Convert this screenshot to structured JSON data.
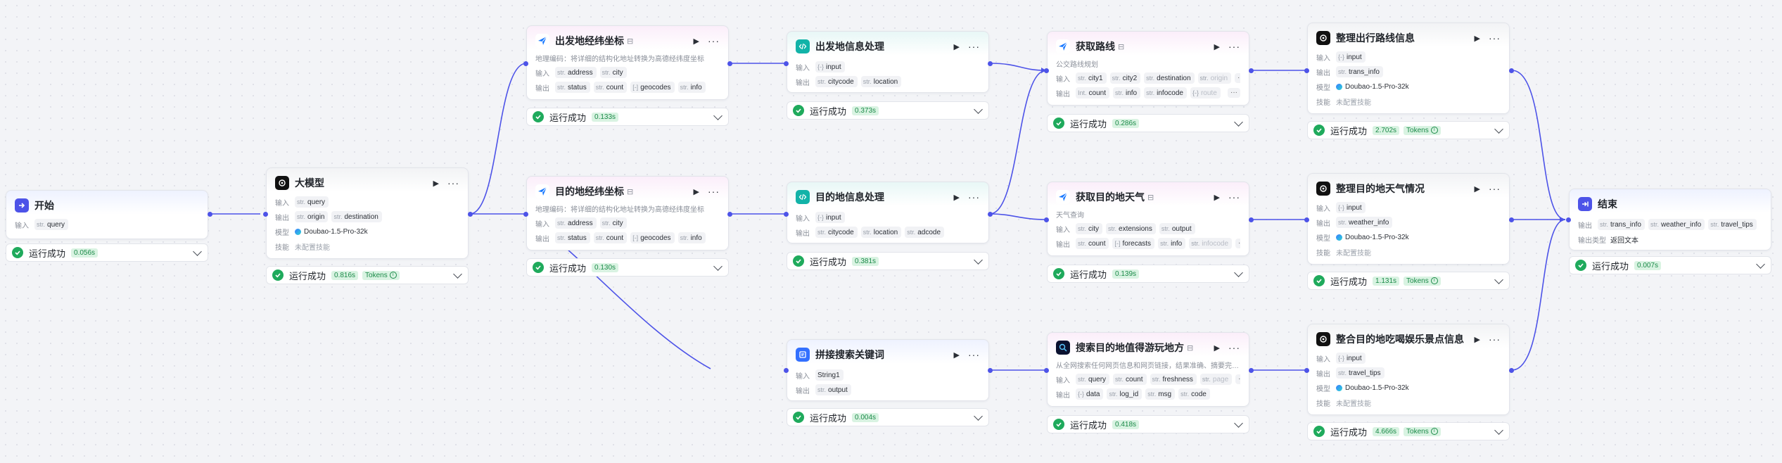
{
  "nodes": {
    "start": {
      "title": "开始",
      "in_label": "输入",
      "params": [
        {
          "t": "str.",
          "n": "query"
        }
      ],
      "status": "运行成功",
      "time": "0.056s"
    },
    "llm": {
      "title": "大模型",
      "in_label": "输入",
      "out_label": "输出",
      "model_label": "模型",
      "skill_label": "技能",
      "inputs": [
        {
          "t": "str.",
          "n": "query"
        }
      ],
      "outputs": [
        {
          "t": "str.",
          "n": "origin"
        },
        {
          "t": "str.",
          "n": "destination"
        }
      ],
      "model": "Doubao-1.5-Pro-32k",
      "skill": "未配置技能",
      "status": "运行成功",
      "time": "0.816s",
      "tokens": "Tokens"
    },
    "geo1": {
      "title": "出发地经纬坐标",
      "desc": "地理编码：将详细的结构化地址转换为高德经纬度坐标",
      "in_label": "输入",
      "out_label": "输出",
      "inputs": [
        {
          "t": "str.",
          "n": "address"
        },
        {
          "t": "str.",
          "n": "city"
        }
      ],
      "outputs": [
        {
          "t": "str.",
          "n": "status"
        },
        {
          "t": "str.",
          "n": "count"
        },
        {
          "t": "[-]",
          "n": "geocodes"
        },
        {
          "t": "str.",
          "n": "info"
        }
      ],
      "status": "运行成功",
      "time": "0.133s"
    },
    "geo2": {
      "title": "目的地经纬坐标",
      "desc": "地理编码：将详细的结构化地址转换为高德经纬度坐标",
      "in_label": "输入",
      "out_label": "输出",
      "inputs": [
        {
          "t": "str.",
          "n": "address"
        },
        {
          "t": "str.",
          "n": "city"
        }
      ],
      "outputs": [
        {
          "t": "str.",
          "n": "status"
        },
        {
          "t": "str.",
          "n": "count"
        },
        {
          "t": "[-]",
          "n": "geocodes"
        },
        {
          "t": "str.",
          "n": "info"
        }
      ],
      "status": "运行成功",
      "time": "0.130s"
    },
    "code1": {
      "title": "出发地信息处理",
      "in_label": "输入",
      "out_label": "输出",
      "inputs": [
        {
          "t": "{-}",
          "n": "input"
        }
      ],
      "outputs": [
        {
          "t": "str.",
          "n": "citycode"
        },
        {
          "t": "str.",
          "n": "location"
        }
      ],
      "status": "运行成功",
      "time": "0.373s"
    },
    "code2": {
      "title": "目的地信息处理",
      "in_label": "输入",
      "out_label": "输出",
      "inputs": [
        {
          "t": "{-}",
          "n": "input"
        }
      ],
      "outputs": [
        {
          "t": "str.",
          "n": "citycode"
        },
        {
          "t": "str.",
          "n": "location"
        },
        {
          "t": "str.",
          "n": "adcode"
        }
      ],
      "status": "运行成功",
      "time": "0.381s"
    },
    "text": {
      "title": "拼接搜索关键词",
      "in_label": "输入",
      "out_label": "输出",
      "inputs": [
        {
          "t": "",
          "n": "String1"
        }
      ],
      "outputs": [
        {
          "t": "str.",
          "n": "output"
        }
      ],
      "status": "运行成功",
      "time": "0.004s"
    },
    "route": {
      "title": "获取路线",
      "desc": "公交路线规划",
      "in_label": "输入",
      "out_label": "输出",
      "inputs": [
        {
          "t": "str.",
          "n": "city1"
        },
        {
          "t": "str.",
          "n": "city2"
        },
        {
          "t": "str.",
          "n": "destination"
        },
        {
          "t": "str.",
          "n": "origin"
        }
      ],
      "outputs": [
        {
          "t": "Int.",
          "n": "count"
        },
        {
          "t": "str.",
          "n": "info"
        },
        {
          "t": "str.",
          "n": "infocode"
        },
        {
          "t": "{-}",
          "n": "route"
        }
      ],
      "overflow": "···",
      "status": "运行成功",
      "time": "0.286s"
    },
    "weather": {
      "title": "获取目的地天气",
      "desc": "天气查询",
      "in_label": "输入",
      "out_label": "输出",
      "inputs": [
        {
          "t": "str.",
          "n": "city"
        },
        {
          "t": "str.",
          "n": "extensions"
        },
        {
          "t": "str.",
          "n": "output"
        }
      ],
      "outputs": [
        {
          "t": "str.",
          "n": "count"
        },
        {
          "t": "[-]",
          "n": "forecasts"
        },
        {
          "t": "str.",
          "n": "info"
        },
        {
          "t": "str.",
          "n": "infocode"
        }
      ],
      "overflow": "···",
      "status": "运行成功",
      "time": "0.139s"
    },
    "search": {
      "title": "搜索目的地值得游玩地方",
      "desc": "从全网搜索任何网页信息和网页链接，结果准确、摘要完整。",
      "in_label": "输入",
      "out_label": "输出",
      "inputs": [
        {
          "t": "str.",
          "n": "query"
        },
        {
          "t": "str.",
          "n": "count"
        },
        {
          "t": "str.",
          "n": "freshness"
        },
        {
          "t": "str.",
          "n": "page"
        }
      ],
      "outputs": [
        {
          "t": "{-}",
          "n": "data"
        },
        {
          "t": "str.",
          "n": "log_id"
        },
        {
          "t": "str.",
          "n": "msg"
        },
        {
          "t": "str.",
          "n": "code"
        }
      ],
      "overflow": "···",
      "status": "运行成功",
      "time": "0.418s"
    },
    "llm_route": {
      "title": "整理出行路线信息",
      "in_label": "输入",
      "out_label": "输出",
      "model_label": "模型",
      "skill_label": "技能",
      "inputs": [
        {
          "t": "{-}",
          "n": "input"
        }
      ],
      "outputs": [
        {
          "t": "str.",
          "n": "trans_info"
        }
      ],
      "model": "Doubao-1.5-Pro-32k",
      "skill": "未配置技能",
      "status": "运行成功",
      "time": "2.702s",
      "tokens": "Tokens"
    },
    "llm_weather": {
      "title": "整理目的地天气情况",
      "in_label": "输入",
      "out_label": "输出",
      "model_label": "模型",
      "skill_label": "技能",
      "inputs": [
        {
          "t": "{-}",
          "n": "input"
        }
      ],
      "outputs": [
        {
          "t": "str.",
          "n": "weather_info"
        }
      ],
      "model": "Doubao-1.5-Pro-32k",
      "skill": "未配置技能",
      "status": "运行成功",
      "time": "1.131s",
      "tokens": "Tokens"
    },
    "llm_fun": {
      "title": "整合目的地吃喝娱乐景点信息",
      "in_label": "输入",
      "out_label": "输出",
      "model_label": "模型",
      "skill_label": "技能",
      "inputs": [
        {
          "t": "{-}",
          "n": "input"
        }
      ],
      "outputs": [
        {
          "t": "str.",
          "n": "travel_tips"
        }
      ],
      "model": "Doubao-1.5-Pro-32k",
      "skill": "未配置技能",
      "status": "运行成功",
      "time": "4.666s",
      "tokens": "Tokens"
    },
    "end": {
      "title": "结束",
      "out_label": "输出",
      "type_label": "输出类型",
      "outputs": [
        {
          "t": "str.",
          "n": "trans_info"
        },
        {
          "t": "str.",
          "n": "weather_info"
        },
        {
          "t": "str.",
          "n": "travel_tips"
        }
      ],
      "type_value": "返回文本",
      "status": "运行成功",
      "time": "0.007s"
    }
  },
  "colors": {
    "edge": "#4d53e8",
    "success": "#1faa5c",
    "accent": "#4d53e8"
  }
}
